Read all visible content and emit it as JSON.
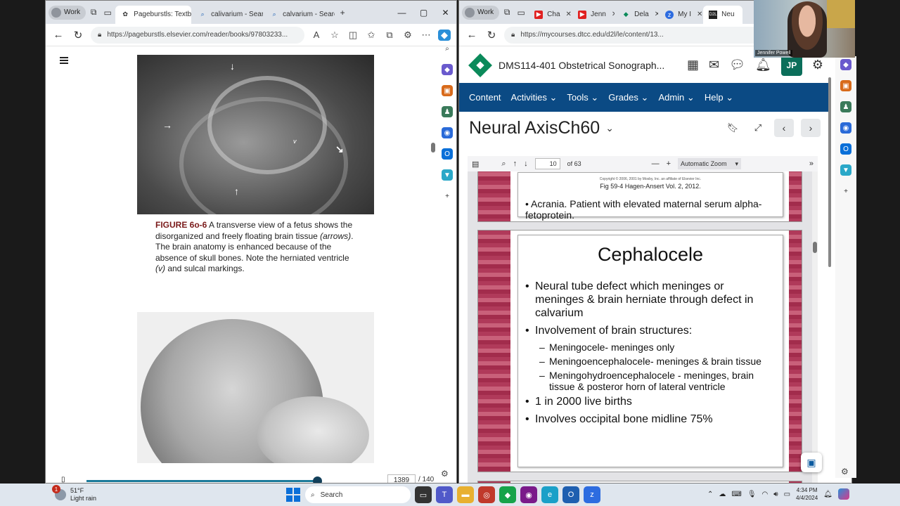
{
  "left_browser": {
    "profile": "Work",
    "tabs": [
      {
        "label": "Pageburstls: Textb",
        "active": true
      },
      {
        "label": "calivarium - Searc",
        "active": false
      },
      {
        "label": "calvarium - Searc",
        "active": false
      }
    ],
    "url": "https://pageburstls.elsevier.com/reader/books/97803233...",
    "caption_label": "FIGURE 6o-6",
    "caption_text": " A transverse view of a fetus shows the disorganized and freely floating brain tissue ",
    "caption_italic1": "(arrows)",
    "caption_text2": ". The brain anatomy is enhanced because of the absence of skull bones. Note the herniated ventricle ",
    "caption_italic2": "(v)",
    "caption_text3": " and sulcal markings.",
    "image_label_v": "v",
    "page_current": "1389",
    "page_total": "/ 140"
  },
  "right_browser": {
    "profile": "Work",
    "tabs": [
      {
        "label": "Cha",
        "active": false
      },
      {
        "label": "Jenn",
        "active": false
      },
      {
        "label": "Dela",
        "active": false
      },
      {
        "label": "My I",
        "active": false
      },
      {
        "label": "Neu",
        "active": true
      }
    ],
    "url": "https://mycourses.dtcc.edu/d2l/le/content/13...",
    "course_title": "DMS114-401 Obstetrical Sonograph...",
    "user_initials": "JP",
    "nav_items": [
      "Content",
      "Activities",
      "Tools",
      "Grades",
      "Admin",
      "Help"
    ],
    "doc_title": "Neural AxisCh60",
    "pdf": {
      "page": "10",
      "of_pages": "of 63",
      "zoom": "Automatic Zoom"
    },
    "slide1": {
      "copyright": "Copyright © 2006, 2001 by Mosby, Inc. an affiliate of Elsevier Inc.",
      "fig_ref": "Fig 59-4 Hagen-Ansert Vol. 2,  2012.",
      "bullet": "Acrania. Patient with elevated maternal serum alpha-fetoprotein."
    },
    "slide2": {
      "title": "Cephalocele",
      "bullets": [
        "Neural tube defect which meninges or meninges & brain herniate through defect in calvarium",
        "Involvement of brain structures:"
      ],
      "sub_bullets": [
        "Meningocele- meninges only",
        "Meningoencephalocele- meninges & brain tissue",
        "Meningohydroencephalocele - meninges, brain tissue & posteror horn of lateral ventricle"
      ],
      "bullets_after": [
        "1 in 2000 live births",
        "Involves occipital bone midline 75%"
      ]
    }
  },
  "webcam": {
    "name": "Jennifer Powell"
  },
  "taskbar": {
    "weather_temp": "51°F",
    "weather_desc": "Light rain",
    "weather_badge": "1",
    "search_label": "Search",
    "time": "4:34 PM",
    "date": "4/4/2024"
  },
  "colors": {
    "d2l_nav": "#0b4a84",
    "d2l_green": "#0b8a5a",
    "slide_border": "#b03a5a",
    "caption_fig": "#7a1a1a"
  }
}
